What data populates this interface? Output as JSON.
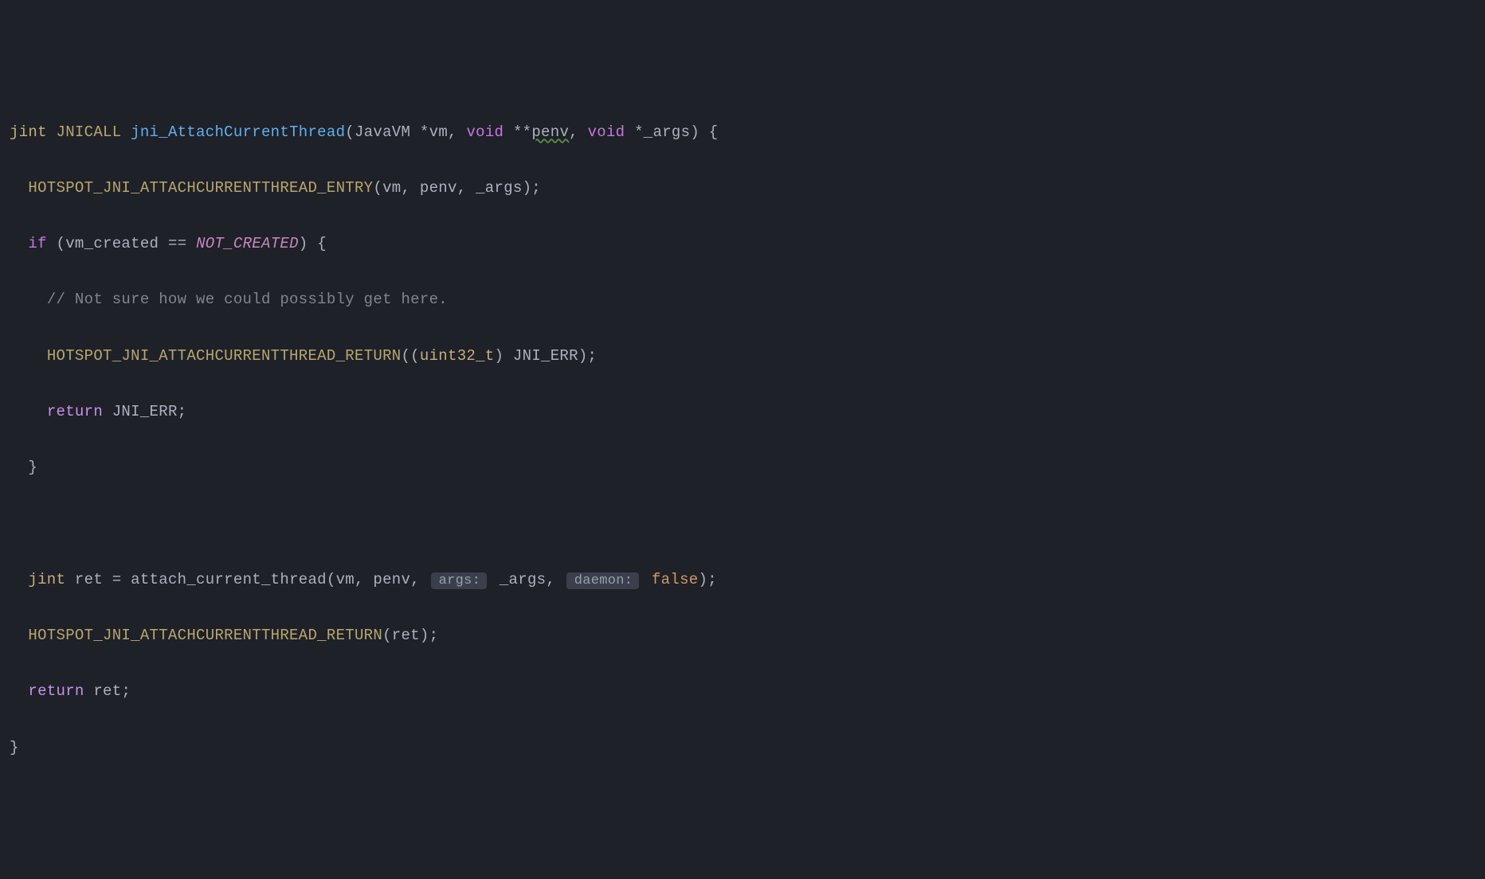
{
  "code": {
    "line1": {
      "type1": "jint",
      "macro_call": "JNICALL",
      "fn": "jni_AttachCurrentThread",
      "paren_open": "(",
      "p1_type": "JavaVM",
      "p1_ptr": "*",
      "p1_name": "vm",
      "comma1": ",",
      "p2_type": "void",
      "p2_ptr": "**",
      "p2_name": "penv",
      "comma2": ",",
      "p3_type": "void",
      "p3_ptr": "*",
      "p3_name": "_args",
      "paren_close": ")",
      "brace": "{"
    },
    "line2": {
      "macro": "HOTSPOT_JNI_ATTACHCURRENTTHREAD_ENTRY",
      "args": "(vm, penv, _args);"
    },
    "line3": {
      "if_kw": "if",
      "cond_open": "(",
      "var": "vm_created",
      "eq": "==",
      "constant": "NOT_CREATED",
      "cond_close": ")",
      "brace": "{"
    },
    "line4": {
      "comment": "// Not sure how we could possibly get here."
    },
    "line5": {
      "macro": "HOTSPOT_JNI_ATTACHCURRENTTHREAD_RETURN",
      "paren_open": "((",
      "cast_type": "uint32_t",
      "paren_mid": ")",
      "val": "JNI_ERR",
      "paren_close": ");"
    },
    "line6": {
      "return_kw": "return",
      "val": "JNI_ERR",
      "semi": ";"
    },
    "line7": {
      "brace": "}"
    },
    "line9": {
      "type": "jint",
      "var": "ret",
      "eq": "=",
      "fn": "attach_current_thread",
      "args_open": "(vm, penv,",
      "hint1": "args:",
      "arg3": "_args,",
      "hint2": "daemon:",
      "arg4": "false",
      "close": ");"
    },
    "line10": {
      "macro": "HOTSPOT_JNI_ATTACHCURRENTTHREAD_RETURN",
      "args": "(ret);"
    },
    "line11": {
      "return_kw": "return",
      "var": "ret",
      "semi": ";"
    },
    "line12": {
      "brace": "}"
    }
  }
}
